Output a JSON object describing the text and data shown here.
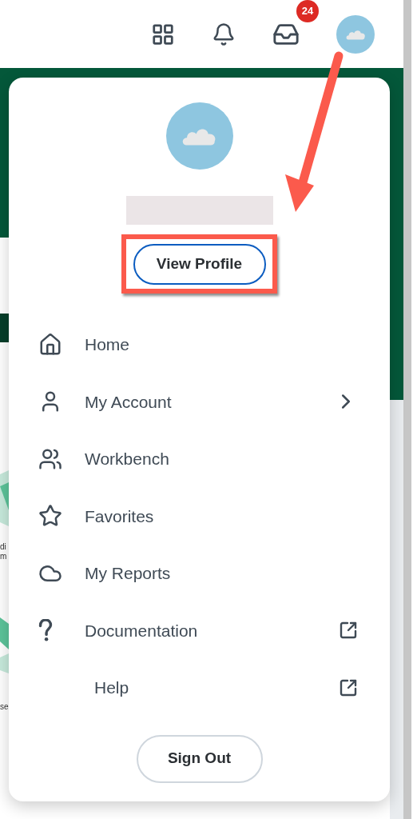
{
  "top_bar": {
    "inbox_badge": "24"
  },
  "background": {
    "edge_texts": [
      "di",
      "m",
      "se"
    ]
  },
  "profile_menu": {
    "view_profile_button": {
      "label": "View Profile",
      "highlighted": true
    },
    "items": [
      {
        "label": "Home",
        "kind": "plain"
      },
      {
        "label": "My Account",
        "kind": "submenu"
      },
      {
        "label": "Workbench",
        "kind": "plain"
      },
      {
        "label": "Favorites",
        "kind": "plain"
      },
      {
        "label": "My Reports",
        "kind": "plain"
      },
      {
        "label": "Documentation",
        "kind": "external"
      },
      {
        "label": "Help",
        "kind": "external"
      }
    ],
    "sign_out_button": "Sign Out"
  }
}
